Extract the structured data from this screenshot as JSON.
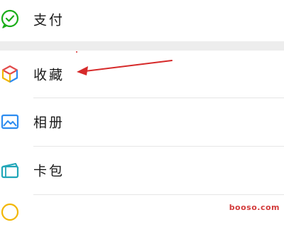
{
  "menu": {
    "items": [
      {
        "label": "支付",
        "icon": "wechat-pay-icon"
      },
      {
        "label": "收藏",
        "icon": "favorites-cube-icon"
      },
      {
        "label": "相册",
        "icon": "album-image-icon"
      },
      {
        "label": "卡包",
        "icon": "card-wallet-icon"
      },
      {
        "label": "",
        "icon": "emoji-icon"
      }
    ]
  },
  "annotation": {
    "color": "#d62a2a"
  },
  "watermark": {
    "text": "booso.com"
  },
  "colors": {
    "pay_green": "#1aad19",
    "separator": "#ededed",
    "album_blue": "#2d8cf0",
    "card_teal": "#20a6b8"
  }
}
